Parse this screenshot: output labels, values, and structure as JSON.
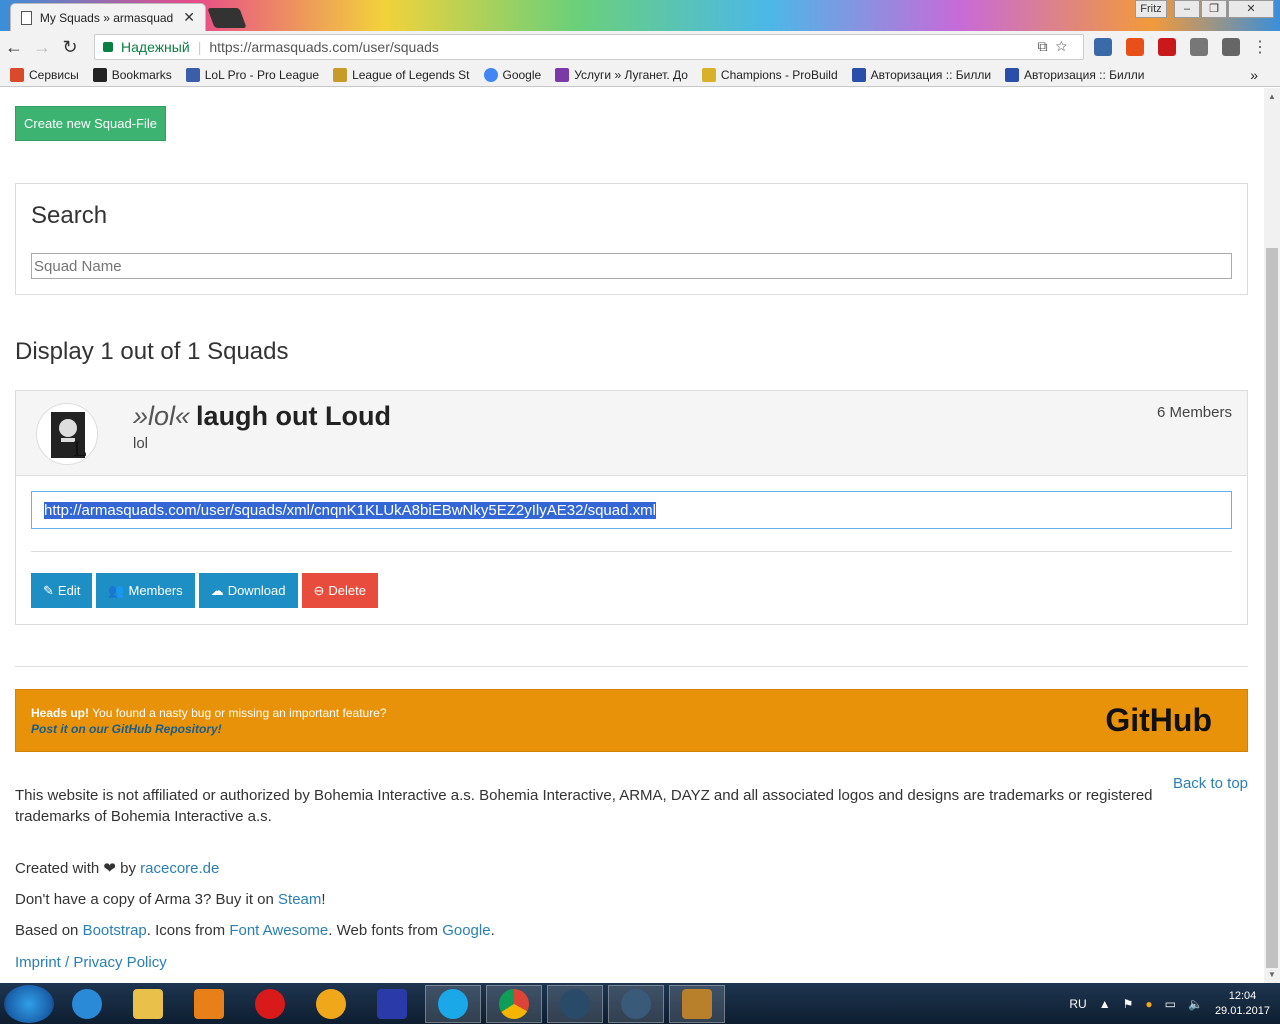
{
  "browser": {
    "tab_title": "My Squads » armasquad",
    "tab_close": "✕",
    "profile_name": "Fritz",
    "back": "←",
    "forward": "→",
    "reload": "↻",
    "secure_label": "Надежный",
    "url": "https://armasquads.com/user/squads",
    "omni_icons": "⧉☆",
    "menu": "⋮",
    "bookmarks": [
      {
        "label": "Сервисы",
        "color": "#d84a2a"
      },
      {
        "label": "Bookmarks",
        "color": "#222222"
      },
      {
        "label": "LoL Pro - Pro League",
        "color": "#3a5fa8"
      },
      {
        "label": "League of Legends St",
        "color": "#c89a2a"
      },
      {
        "label": "Google",
        "color": "#4285f4"
      },
      {
        "label": "Услуги » Луганет. До",
        "color": "#7a3aa8"
      },
      {
        "label": "Champions - ProBuild",
        "color": "#d8b02a"
      },
      {
        "label": "Авторизация :: Билли",
        "color": "#2a4fa8"
      },
      {
        "label": "Авторизация :: Билли",
        "color": "#2a4fa8"
      }
    ],
    "bookmarks_overflow": "»"
  },
  "page": {
    "create_button": "Create new Squad-File",
    "search_title": "Search",
    "search_placeholder": "Squad Name",
    "display_heading": "Display 1 out of 1 Squads",
    "squad": {
      "tag": "»lol«",
      "name": "laugh out Loud",
      "subtitle": "lol",
      "members": "6 Members",
      "xml_url": "http://armasquads.com/user/squads/xml/cnqnK1KLUkA8biEBwNky5EZ2yIlyAE32/squad.xml",
      "actions": [
        {
          "icon": "✎",
          "label": "Edit",
          "icon_name": "edit-icon"
        },
        {
          "icon": "👥",
          "label": "Members",
          "icon_name": "users-icon"
        },
        {
          "icon": "☁",
          "label": "Download",
          "icon_name": "cloud-download-icon"
        },
        {
          "icon": "⊖",
          "label": "Delete",
          "icon_name": "minus-circle-icon"
        }
      ]
    },
    "alert": {
      "bold": "Heads up!",
      "text": " You found a nasty bug or missing an important feature?",
      "link": "Post it on our GitHub Repository!",
      "logo": "GitHub"
    },
    "back_to_top": "Back to top",
    "disclaimer": "This website is not affiliated or authorized by Bohemia Interactive a.s. Bohemia Interactive, ARMA, DAYZ and all associated logos and designs are trademarks or registered trademarks of Bohemia Interactive a.s.",
    "created_with": {
      "prefix": "Created with ",
      "heart": "❤",
      "by": " by ",
      "link": "racecore.de"
    },
    "buy": {
      "prefix": "Don't have a copy of Arma 3? Buy it on ",
      "link": "Steam",
      "suffix": "!"
    },
    "based": {
      "p1": "Based on ",
      "l1": "Bootstrap",
      "p2": ". Icons from ",
      "l2": "Font Awesome",
      "p3": ". Web fonts from ",
      "l3": "Google",
      "p4": "."
    },
    "imprint": "Imprint / Privacy Policy"
  },
  "taskbar": {
    "apps": [
      {
        "name": "internet-explorer",
        "color": "#2a8ad8"
      },
      {
        "name": "file-explorer",
        "color": "#e8c04a"
      },
      {
        "name": "media-player",
        "color": "#e8801a"
      },
      {
        "name": "opera",
        "color": "#d81a1a"
      },
      {
        "name": "aimp",
        "color": "#f0a81a"
      },
      {
        "name": "save-app",
        "color": "#2a3aa8"
      },
      {
        "name": "skype",
        "color": "#1aa8e8"
      },
      {
        "name": "chrome",
        "color": "#3aa84a"
      },
      {
        "name": "steam",
        "color": "#2a4a6a"
      },
      {
        "name": "teamspeak",
        "color": "#3a5a7a"
      },
      {
        "name": "game",
        "color": "#b8802a"
      }
    ],
    "lang": "RU",
    "time": "12:04",
    "date": "29.01.2017"
  }
}
